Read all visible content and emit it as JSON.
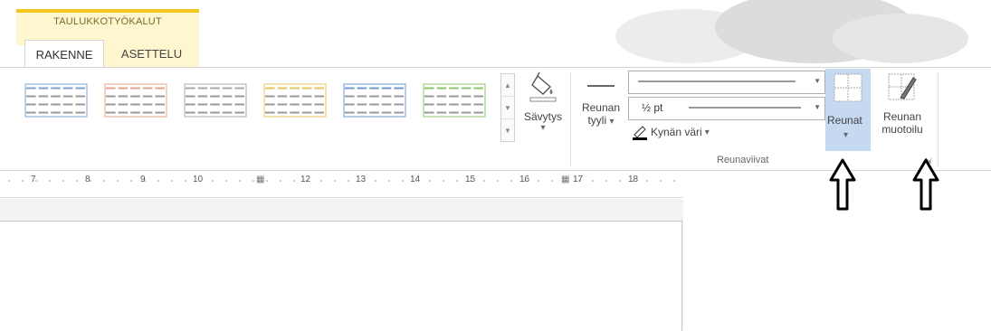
{
  "contextual": {
    "title": "TAULUKKOTYÖKALUT"
  },
  "tabs": [
    {
      "label": "RAKENNE",
      "active": true
    },
    {
      "label": "ASETTELU",
      "active": false
    }
  ],
  "table_styles": [
    {
      "color": "#7da4cf"
    },
    {
      "color": "#e6a58a"
    },
    {
      "color": "#a8a8a8"
    },
    {
      "color": "#e8c55b"
    },
    {
      "color": "#6f9ad0"
    },
    {
      "color": "#8fc46b"
    }
  ],
  "shading": {
    "label": "Sävytys",
    "arrow": "▾"
  },
  "border_style": {
    "line1": "Reunan",
    "line2": "tyyli",
    "arrow": "▾"
  },
  "pen_weight": {
    "value": "½ pt"
  },
  "pen_color": {
    "label": "Kynän väri",
    "arrow": "▾"
  },
  "borders": {
    "label": "Reunat",
    "arrow": "▾"
  },
  "border_painter": {
    "line1": "Reunan",
    "line2": "muotoilu"
  },
  "group_label": "Reunaviivat",
  "ruler": [
    "7",
    "8",
    "9",
    "10",
    "12",
    "13",
    "14",
    "15",
    "16",
    "17",
    "18"
  ],
  "colors": {
    "accent_yellow": "#f2c61f",
    "selected_blue": "#c5d9f1"
  }
}
